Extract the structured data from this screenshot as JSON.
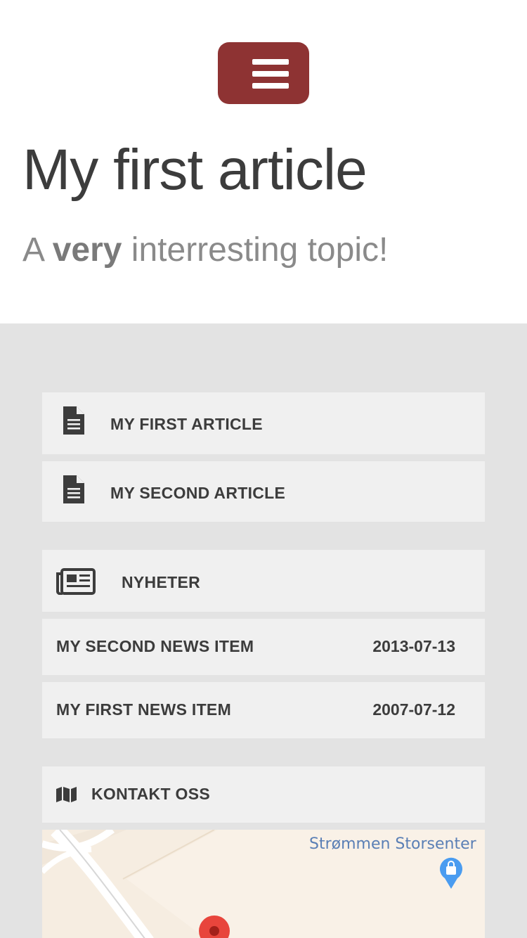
{
  "header": {
    "title": "My first article",
    "subtitle_pre": "A ",
    "subtitle_bold": "very",
    "subtitle_post": " interresting topic!"
  },
  "articles": [
    {
      "label": "MY FIRST ARTICLE",
      "icon": "document-icon"
    },
    {
      "label": "MY SECOND ARTICLE",
      "icon": "document-icon"
    }
  ],
  "news": {
    "heading": "NYHETER",
    "icon": "newspaper-icon",
    "items": [
      {
        "title": "MY SECOND NEWS ITEM",
        "date": "2013-07-13"
      },
      {
        "title": "MY FIRST NEWS ITEM",
        "date": "2007-07-12"
      }
    ]
  },
  "contact": {
    "heading": "KONTAKT OSS",
    "icon": "map-icon",
    "map": {
      "place_label": "Strømmen Storsenter"
    }
  },
  "colors": {
    "accent": "#8e3333",
    "grey_bg": "#e3e3e3",
    "box_bg": "#f0f0f0",
    "text": "#3c3c3c"
  }
}
